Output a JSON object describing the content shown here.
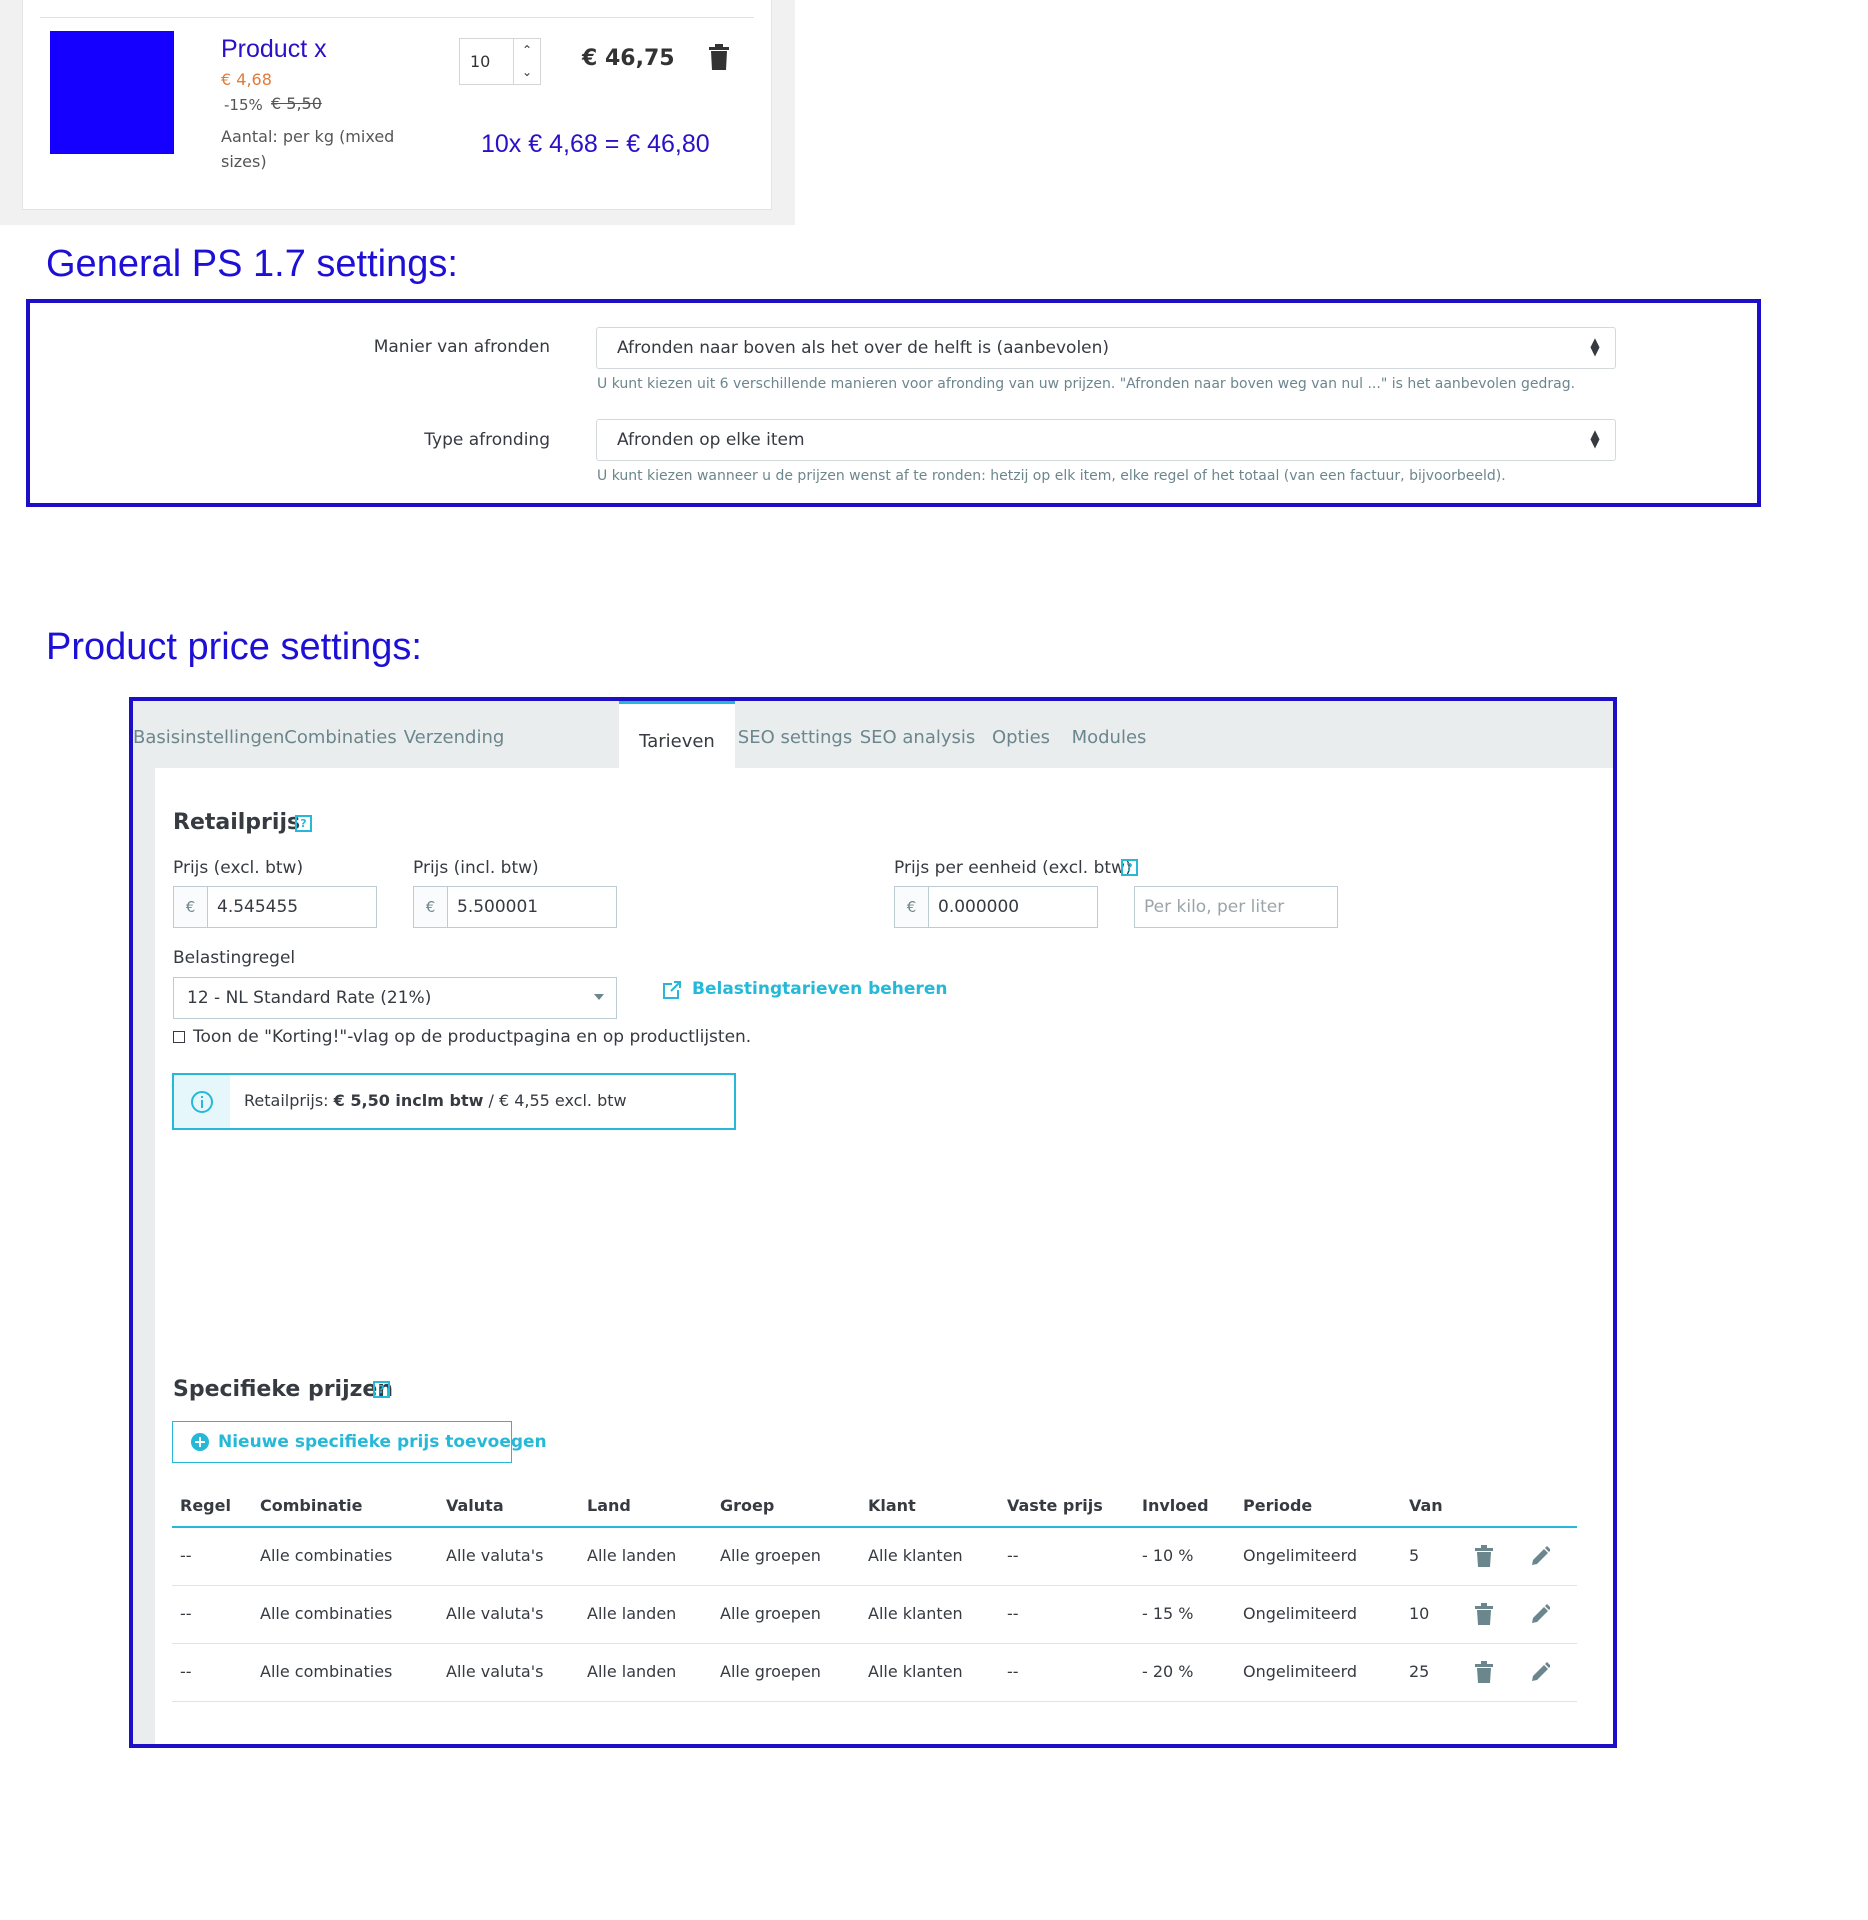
{
  "cart": {
    "product_name": "Product x",
    "price_new": "€ 4,68",
    "discount_pct": "-15%",
    "price_old": "€ 5,50",
    "unit_text": "Aantal: per kg (mixed sizes)",
    "quantity": "10",
    "line_total": "€ 46,75",
    "calculation_text": "10x € 4,68 = € 46,80",
    "product_image_color": "#1500ff"
  },
  "headings": {
    "general": "General PS 1.7 settings:",
    "product": "Product price settings:"
  },
  "general_settings": {
    "rounding_mode": {
      "label": "Manier van afronden",
      "value": "Afronden naar boven als het over de helft is (aanbevolen)",
      "help": "U kunt kiezen uit 6 verschillende manieren voor afronding van uw prijzen. \"Afronden naar boven weg van nul ...\" is het aanbevolen gedrag."
    },
    "rounding_type": {
      "label": "Type afronding",
      "value": "Afronden op elke item",
      "help": "U kunt kiezen wanneer u de prijzen wenst af te ronden: hetzij op elk item, elke regel of het totaal (van een factuur, bijvoorbeeld)."
    }
  },
  "tabs": [
    {
      "label": "Basisinstellingen",
      "active": false
    },
    {
      "label": "Combinaties",
      "active": false
    },
    {
      "label": "Verzending",
      "active": false
    },
    {
      "label": "Tarieven",
      "active": true
    },
    {
      "label": "SEO settings",
      "active": false
    },
    {
      "label": "SEO analysis",
      "active": false
    },
    {
      "label": "Opties",
      "active": false
    },
    {
      "label": "Modules",
      "active": false
    }
  ],
  "retail": {
    "title": "Retailprijs",
    "help_badge": "?",
    "price_excl_label": "Prijs (excl. btw)",
    "price_excl_value": "4.545455",
    "price_incl_label": "Prijs (incl. btw)",
    "price_incl_value": "5.500001",
    "currency_symbol": "€",
    "unit_price_label": "Prijs per eenheid (excl. btw)",
    "unit_price_value": "0.000000",
    "unit_label_placeholder": "Per kilo, per liter",
    "tax_rule_label": "Belastingregel",
    "tax_rule_value": "12 - NL Standard Rate (21%)",
    "tax_link": "Belastingtarieven beheren",
    "discount_flag_label": "Toon de \"Korting!\"-vlag op de productpagina en op productlijsten.",
    "discount_flag_checked": false,
    "alert": {
      "prefix": "Retailprijs: ",
      "incl": "€ 5,50 inclm btw",
      "suffix": " / € 4,55 excl. btw"
    }
  },
  "specific_prices": {
    "title": "Specifieke prijzen",
    "add_button": "Nieuwe specifieke prijs toevoegen",
    "columns": [
      "Regel",
      "Combinatie",
      "Valuta",
      "Land",
      "Groep",
      "Klant",
      "Vaste prijs",
      "Invloed",
      "Periode",
      "Van"
    ],
    "rows": [
      [
        "--",
        "Alle combinaties",
        "Alle valuta's",
        "Alle landen",
        "Alle groepen",
        "Alle klanten",
        "--",
        "- 10 %",
        "Ongelimiteerd",
        "5"
      ],
      [
        "--",
        "Alle combinaties",
        "Alle valuta's",
        "Alle landen",
        "Alle groepen",
        "Alle klanten",
        "--",
        "- 15 %",
        "Ongelimiteerd",
        "10"
      ],
      [
        "--",
        "Alle combinaties",
        "Alle valuta's",
        "Alle landen",
        "Alle groepen",
        "Alle klanten",
        "--",
        "- 20 %",
        "Ongelimiteerd",
        "25"
      ]
    ]
  },
  "colors": {
    "accent": "#25b9d7",
    "highlight_border": "#1d0fc6",
    "heading_blue": "#1e0fd6"
  }
}
